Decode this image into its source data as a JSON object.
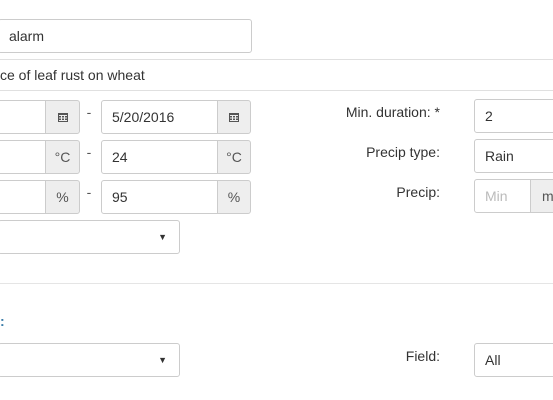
{
  "alarm": {
    "name_value": "alarm"
  },
  "description": {
    "value": "ce of leaf rust on wheat"
  },
  "date_range": {
    "dash": "-",
    "to": "5/20/2016",
    "calendar_icon": "calendar-icon"
  },
  "temperature": {
    "dash": "-",
    "to": "24",
    "unit": "°C"
  },
  "humidity": {
    "dash": "-",
    "to": "95",
    "unit": "%"
  },
  "min_duration": {
    "label": "Min. duration: *",
    "value": "2"
  },
  "precip_type": {
    "label": "Precip type:",
    "value": "Rain"
  },
  "precip": {
    "label": "Precip:",
    "min_placeholder": "Min",
    "unit_partial": "m"
  },
  "select_1": {
    "value": "",
    "caret": "▼"
  },
  "section": {
    "label": ":"
  },
  "select_2": {
    "value": "",
    "caret": "▼"
  },
  "field": {
    "label": "Field:",
    "value": "All"
  }
}
